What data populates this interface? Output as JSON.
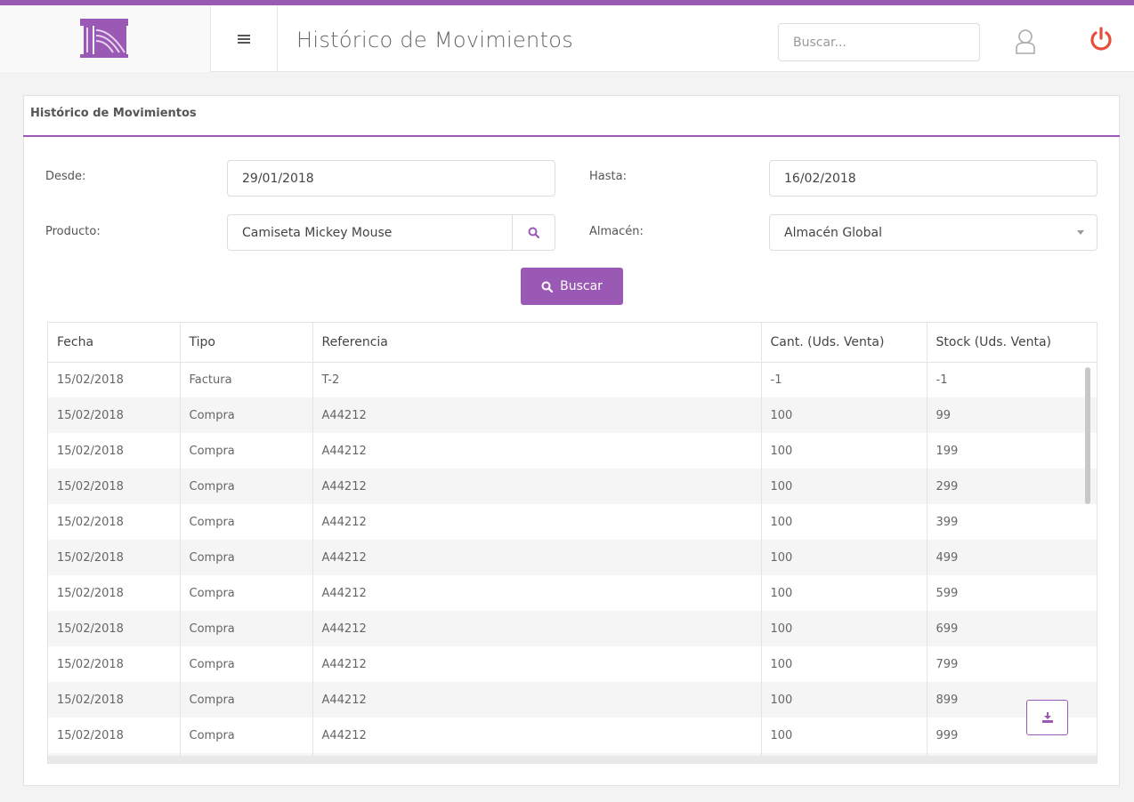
{
  "header": {
    "title": "Histórico de Movimientos",
    "search_placeholder": "Buscar...",
    "menu_icon": "hamburger-menu-icon",
    "accent": "#9b59b6",
    "power_color": "#e74c3c"
  },
  "panel": {
    "title": "Histórico de Movimientos"
  },
  "filters": {
    "desde_label": "Desde:",
    "desde_value": "29/01/2018",
    "hasta_label": "Hasta:",
    "hasta_value": "16/02/2018",
    "producto_label": "Producto:",
    "producto_value": "Camiseta Mickey Mouse",
    "almacen_label": "Almacén:",
    "almacen_value": "Almacén Global",
    "buscar_label": "Buscar"
  },
  "table": {
    "columns": [
      "Fecha",
      "Tipo",
      "Referencia",
      "Cant. (Uds. Venta)",
      "Stock (Uds. Venta)"
    ],
    "rows": [
      [
        "15/02/2018",
        "Factura",
        "T-2",
        "-1",
        "-1"
      ],
      [
        "15/02/2018",
        "Compra",
        "A44212",
        "100",
        "99"
      ],
      [
        "15/02/2018",
        "Compra",
        "A44212",
        "100",
        "199"
      ],
      [
        "15/02/2018",
        "Compra",
        "A44212",
        "100",
        "299"
      ],
      [
        "15/02/2018",
        "Compra",
        "A44212",
        "100",
        "399"
      ],
      [
        "15/02/2018",
        "Compra",
        "A44212",
        "100",
        "499"
      ],
      [
        "15/02/2018",
        "Compra",
        "A44212",
        "100",
        "599"
      ],
      [
        "15/02/2018",
        "Compra",
        "A44212",
        "100",
        "699"
      ],
      [
        "15/02/2018",
        "Compra",
        "A44212",
        "100",
        "799"
      ],
      [
        "15/02/2018",
        "Compra",
        "A44212",
        "100",
        "899"
      ],
      [
        "15/02/2018",
        "Compra",
        "A44212",
        "100",
        "999"
      ]
    ]
  }
}
